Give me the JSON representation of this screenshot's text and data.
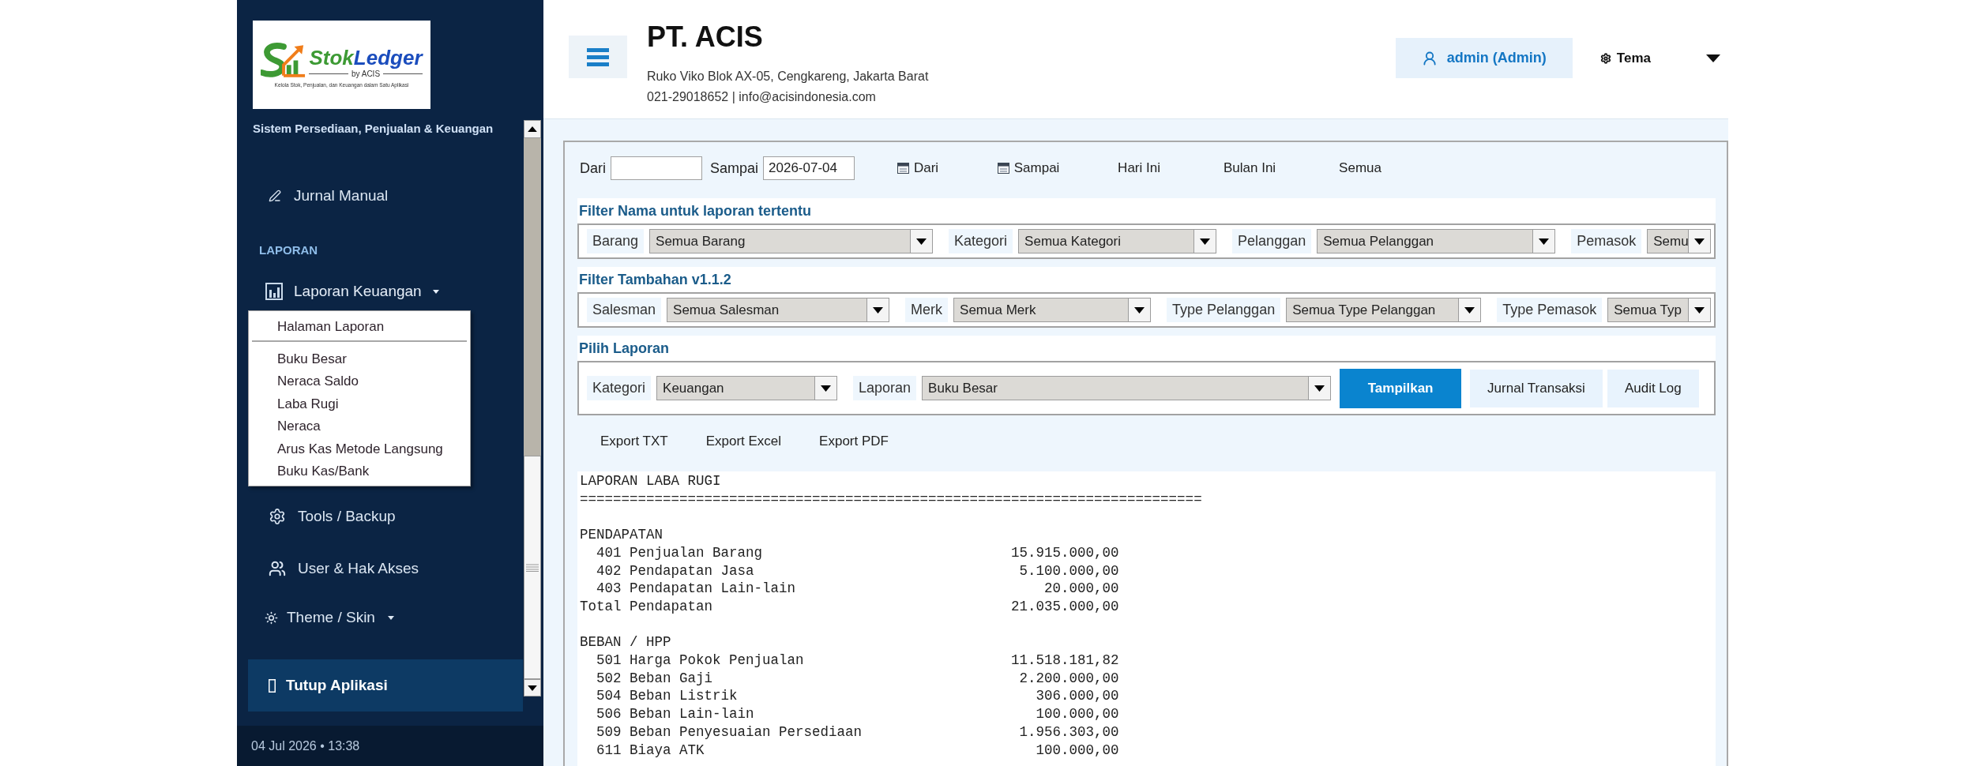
{
  "sidebar": {
    "logo": {
      "wordmark": [
        "Stok",
        "Ledger"
      ],
      "byline": "by ACIS",
      "tagline": "Kelola Stok, Penjualan, dan Keuangan dalam Satu Aplikasi"
    },
    "subtitle": "Sistem Persediaan, Penjualan & Keuangan",
    "journal_link": "Jurnal Manual",
    "reports_heading": "LAPORAN",
    "reports_menu": {
      "label": "Laporan Keuangan",
      "expanded": true,
      "items": [
        {
          "kind": "item",
          "label": "Halaman Laporan"
        },
        {
          "kind": "separator"
        },
        {
          "kind": "item",
          "label": "Buku Besar"
        },
        {
          "kind": "item",
          "label": "Neraca Saldo"
        },
        {
          "kind": "item",
          "label": "Laba Rugi"
        },
        {
          "kind": "item",
          "label": "Neraca"
        },
        {
          "kind": "item",
          "label": "Arus Kas Metode Langsung"
        },
        {
          "kind": "item",
          "label": "Buku Kas/Bank"
        }
      ]
    },
    "tools_link": "Tools / Backup",
    "users_link": "User & Hak Akses",
    "theme_menu": "Theme / Skin",
    "exit_button": "Tutup Aplikasi",
    "footer": "04 Jul 2026 • 13:38"
  },
  "header": {
    "company": "PT. ACIS",
    "address": "Ruko Viko Blok AX-05, Cengkareng, Jakarta Barat",
    "contact": "021-29018652 | info@acisindonesia.com",
    "user_button": "admin (Admin)",
    "theme_dropdown": "Tema"
  },
  "date_range": {
    "from": {
      "label": "Dari"
    },
    "to": {
      "label": "Sampai",
      "value": "2026-07-04"
    },
    "buttons": [
      {
        "kind": "calendar",
        "label": "Dari"
      },
      {
        "kind": "calendar",
        "label": "Sampai"
      },
      {
        "kind": "quick",
        "label": "Hari Ini"
      },
      {
        "kind": "quick",
        "label": "Bulan Ini"
      },
      {
        "kind": "quick",
        "label": "Semua"
      }
    ]
  },
  "filter_sections": [
    {
      "title": "Filter Nama untuk laporan tertentu",
      "fields": [
        {
          "label": "Barang",
          "value": "Semua Barang"
        },
        {
          "label": "Kategori",
          "value": "Semua Kategori"
        },
        {
          "label": "Pelanggan",
          "value": "Semua Pelanggan"
        },
        {
          "label": "Pemasok",
          "value": "Semu"
        }
      ]
    },
    {
      "title": "Filter Tambahan v1.1.2",
      "fields": [
        {
          "label": "Salesman",
          "value": "Semua Salesman"
        },
        {
          "label": "Merk",
          "value": "Semua Merk"
        },
        {
          "label": "Type Pelanggan",
          "value": "Semua Type Pelanggan"
        },
        {
          "label": "Type Pemasok",
          "value": "Semua Typ"
        }
      ]
    },
    {
      "title": "Pilih Laporan",
      "fields": [
        {
          "label": "Kategori",
          "value": "Keuangan"
        },
        {
          "label": "Laporan",
          "value": "Buku Besar"
        }
      ],
      "buttons": [
        {
          "label": "Tampilkan",
          "primary": true
        },
        {
          "label": "Jurnal Transaksi",
          "primary": false
        },
        {
          "label": "Audit Log",
          "primary": false
        }
      ]
    }
  ],
  "export_buttons": [
    "Export TXT",
    "Export Excel",
    "Export PDF"
  ],
  "report": {
    "title": "LAPORAN LABA RUGI",
    "rule": "===========================================================================",
    "sections": [
      {
        "heading": "PENDAPATAN",
        "rows": [
          {
            "kind": "account",
            "label": "401 Penjualan Barang",
            "amount": "15.915.000,00"
          },
          {
            "kind": "account",
            "label": "402 Pendapatan Jasa",
            "amount": "5.100.000,00"
          },
          {
            "kind": "account",
            "label": "403 Pendapatan Lain-lain",
            "amount": "20.000,00"
          },
          {
            "kind": "total",
            "label": "Total Pendapatan",
            "amount": "21.035.000,00"
          }
        ]
      },
      {
        "heading": "BEBAN / HPP",
        "rows": [
          {
            "kind": "account",
            "label": "501 Harga Pokok Penjualan",
            "amount": "11.518.181,82"
          },
          {
            "kind": "account",
            "label": "502 Beban Gaji",
            "amount": "2.200.000,00"
          },
          {
            "kind": "account",
            "label": "504 Beban Listrik",
            "amount": "306.000,00"
          },
          {
            "kind": "account",
            "label": "506 Beban Lain-lain",
            "amount": "100.000,00"
          },
          {
            "kind": "account",
            "label": "509 Beban Penyesuaian Persediaan",
            "amount": "1.956.303,00"
          },
          {
            "kind": "account",
            "label": "611 Biaya ATK",
            "amount": "100.000,00"
          }
        ]
      }
    ]
  }
}
